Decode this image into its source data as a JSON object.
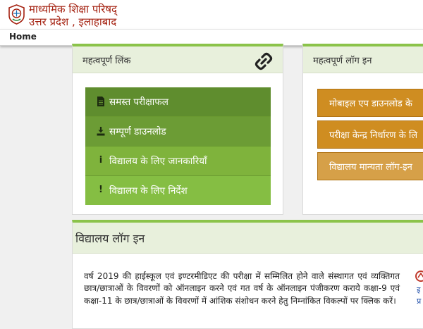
{
  "header": {
    "line1": "माध्यमिक शिक्षा परिषद्",
    "line2": "उत्तर प्रदेश , इलाहाबाद"
  },
  "nav": {
    "home": "Home"
  },
  "links_panel": {
    "title": "महत्वपूर्ण लिंक",
    "items": [
      {
        "label": "समस्त परीक्षाफल",
        "icon": "file-icon"
      },
      {
        "label": "सम्पूर्ण डाउनलोड",
        "icon": "download-icon"
      },
      {
        "label": "विद्यालय के लिए जानकारियाँ",
        "icon": "info-icon"
      },
      {
        "label": "विद्यालय के लिए निर्देश",
        "icon": "exclamation-icon"
      }
    ]
  },
  "login_panel": {
    "title": "महत्वपूर्ण लॉग इन",
    "items": [
      {
        "label": "मोबाइल एप डाउनलोड के"
      },
      {
        "label": "परीक्षा केन्द्र निर्धारण के लि"
      },
      {
        "label": "विद्यालय मान्यता लॉग-इन"
      }
    ]
  },
  "school_login": {
    "title": "विद्यालय लॉग इन",
    "description": "वर्ष 2019 की हाईस्कूल एवं इण्टरमीडिएट की परीक्षा में सम्मिलित होने वाले संस्थागत एवं व्यक्तिगत छात्र/छात्राओं के विवरणों को ऑनलाइन करने एवं गत वर्ष के ऑनलाइन पंजीकरण कराये कक्षा-9 एवं कक्षा-11 के छात्र/छात्राओं के विवरणों में आंशिक संशोधन करने हेतु निम्नांकित विकल्पों पर क्लिक करें।",
    "side_text_1": "इ",
    "side_text_2": "प्र"
  },
  "colors": {
    "header_red": "#a4200f",
    "green_accent": "#8bc34a",
    "orange_button": "#cf8d21"
  }
}
